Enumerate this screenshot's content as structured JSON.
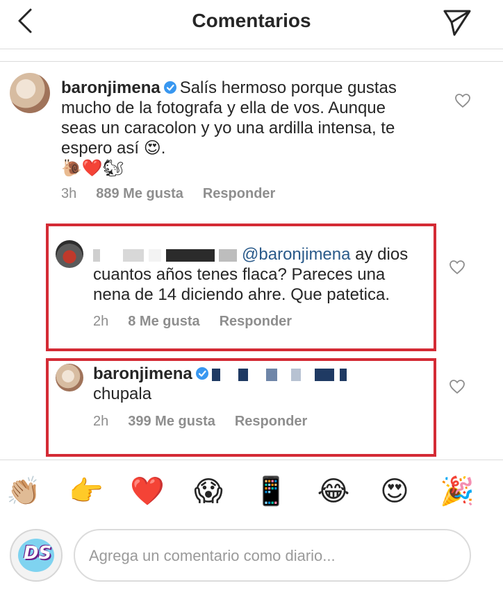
{
  "header": {
    "title": "Comentarios",
    "back_icon": "chevron-left-icon",
    "send_icon": "paper-plane-icon"
  },
  "main_comment": {
    "username": "baronjimena",
    "text_lines": [
      "Salís hermoso porque gustas",
      "mucho de la fotografa y ella de vos. Aunque",
      "seas un caracolon y yo una ardilla intensa, te",
      "espero así 😍."
    ],
    "emoji_line": "🐌❤️🐿",
    "time": "3h",
    "likes": "889 Me gusta",
    "reply": "Responder"
  },
  "reply1": {
    "mention": "@baronjimena",
    "text_first": "ay dios",
    "text_lines": [
      "cuantos años tenes flaca? Pareces una",
      "nena de 14 diciendo ahre. Que patetica."
    ],
    "time": "2h",
    "likes": "8 Me gusta",
    "reply": "Responder"
  },
  "reply2": {
    "username": "baronjimena",
    "text": "chupala",
    "time": "2h",
    "likes": "399 Me gusta",
    "reply": "Responder"
  },
  "emoji_bar": [
    "👏🏼",
    "👉",
    "❤️",
    "😱",
    "📱",
    "😂",
    "😍",
    "🎉"
  ],
  "input": {
    "avatar_label": "DS",
    "placeholder": "Agrega un comentario como diario..."
  },
  "colors": {
    "highlight_border": "#d42b35",
    "verified": "#3897f0",
    "mention": "#2a5a8a",
    "meta_text": "#8e8e8e"
  }
}
